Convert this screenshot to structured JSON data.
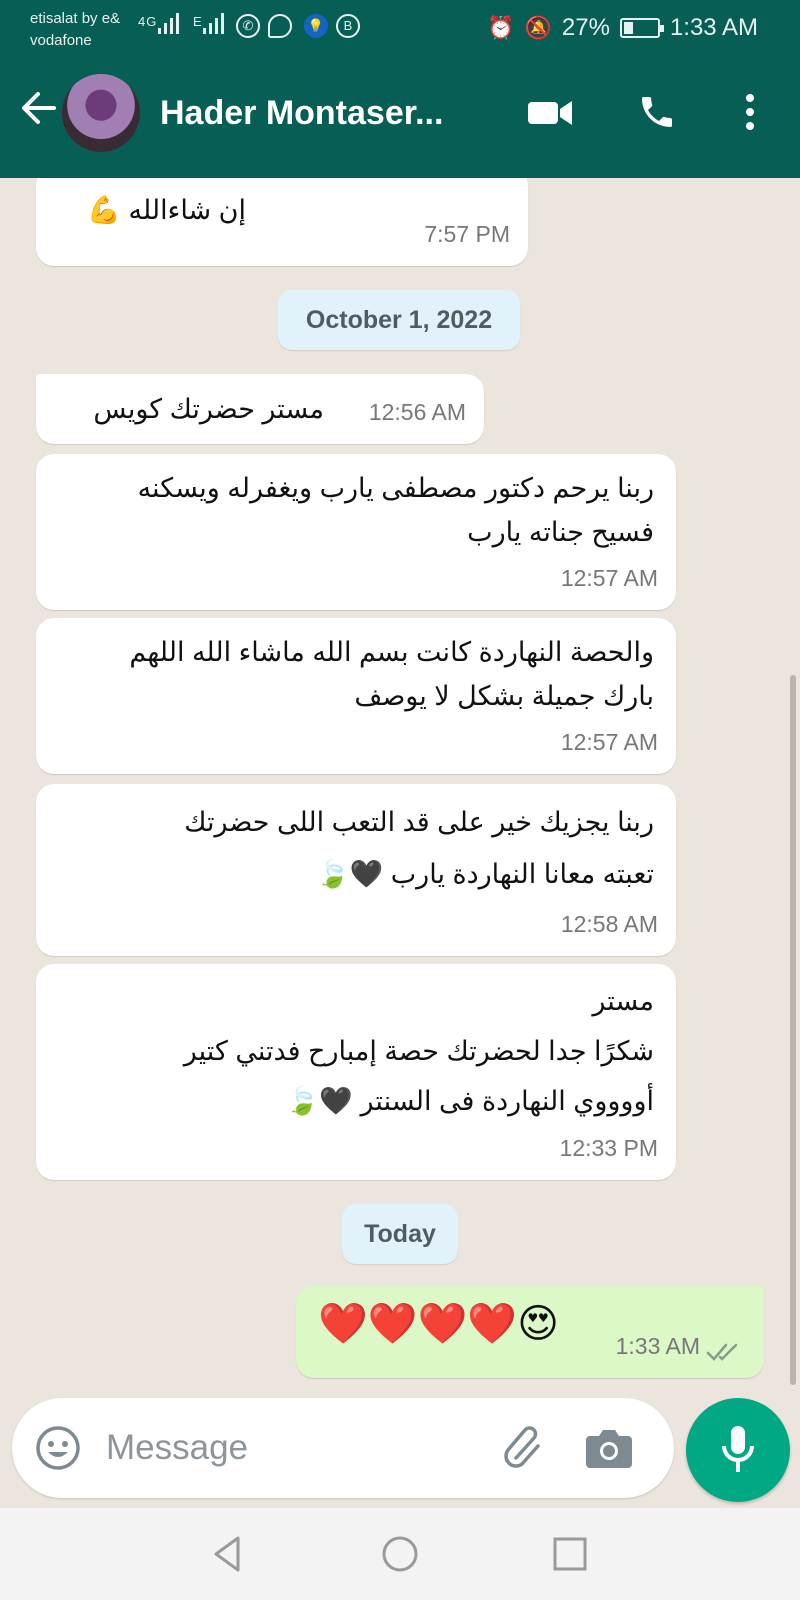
{
  "status_bar": {
    "carrier_line1": "etisalat by e&",
    "carrier_line2": "vodafone",
    "network_4g": "4G",
    "network_e": "E",
    "battery": "27%",
    "time": "1:33 AM"
  },
  "header": {
    "contact_name": "Hader Montaser..."
  },
  "messages": [
    {
      "dir": "in",
      "text": "إن شاءالله 💪",
      "time": "7:57 PM"
    },
    {
      "dir": "in",
      "text": "مستر حضرتك كويس",
      "time": "12:56 AM"
    },
    {
      "dir": "in",
      "text": "ربنا يرحم دكتور مصطفى يارب ويغفرله ويسكنه\nفسيح جناته يارب",
      "time": "12:57 AM"
    },
    {
      "dir": "in",
      "text": "والحصة النهاردة كانت بسم الله ماشاء الله اللهم\nبارك جميلة  بشكل لا يوصف",
      "time": "12:57 AM"
    },
    {
      "dir": "in",
      "text": "ربنا يجزيك خير على قد التعب اللى حضرتك\nتعبته معانا النهاردة يارب 🖤🍃",
      "time": "12:58 AM"
    },
    {
      "dir": "in",
      "text": "مستر\nشكرًا جدا لحضرتك حصة إمبارح فدتني كتير\nأووووي النهاردة فى السنتر 🖤🍃",
      "time": "12:33 PM"
    },
    {
      "dir": "out",
      "text": "❤️❤️❤️❤️😍",
      "time": "1:33 AM"
    }
  ],
  "dates": {
    "date1": "October 1, 2022",
    "date2": "Today"
  },
  "composer": {
    "placeholder": "Message"
  },
  "colors": {
    "header_green": "#075e54",
    "chat_bg": "#ece5dd",
    "outgoing_bubble": "#dcf8c6",
    "mic_button": "#00a884"
  }
}
